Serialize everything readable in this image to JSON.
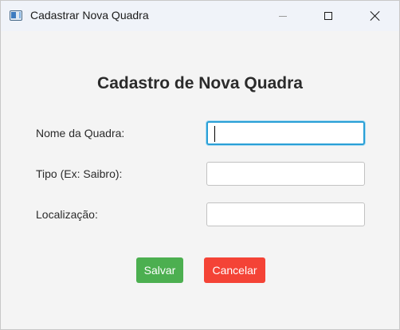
{
  "window": {
    "title": "Cadastrar Nova Quadra"
  },
  "form": {
    "heading": "Cadastro de Nova Quadra",
    "fields": [
      {
        "label": "Nome da Quadra:",
        "value": "",
        "focused": true
      },
      {
        "label": "Tipo (Ex: Saibro):",
        "value": ""
      },
      {
        "label": "Localização:",
        "value": ""
      }
    ]
  },
  "buttons": {
    "save_label": "Salvar",
    "save_color": "#4caf50",
    "cancel_label": "Cancelar",
    "cancel_color": "#f44336"
  },
  "colors": {
    "focus_border": "#2a9fd6",
    "background": "#f4f4f4"
  },
  "icons": {
    "app": "window-app-icon",
    "minimize": "minimize-icon",
    "maximize": "maximize-icon",
    "close": "close-icon"
  }
}
